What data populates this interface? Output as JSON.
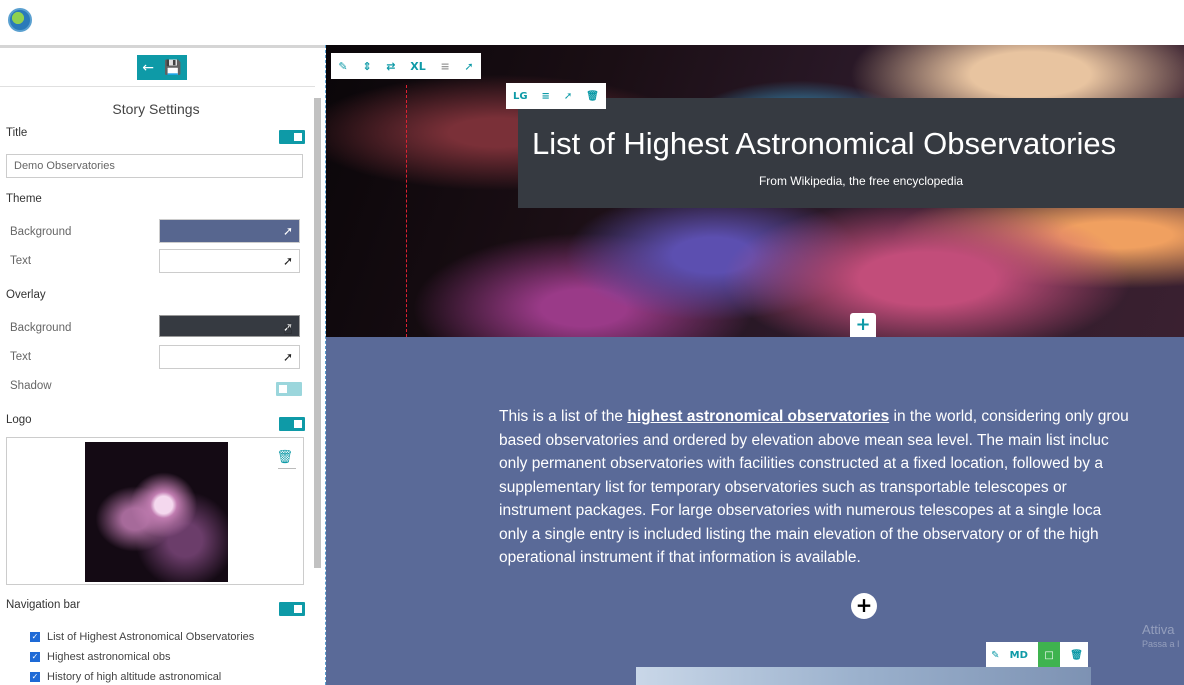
{
  "sidebar": {
    "title": "Story Settings",
    "title_field": {
      "label": "Title",
      "value": "Demo Observatories"
    },
    "theme": {
      "label": "Theme",
      "background": {
        "label": "Background",
        "color": "#57668f"
      },
      "text": {
        "label": "Text",
        "color": "#ffffff"
      }
    },
    "overlay": {
      "label": "Overlay",
      "background": {
        "label": "Background",
        "color": "#363a41"
      },
      "text": {
        "label": "Text",
        "color": "#ffffff"
      },
      "shadow": {
        "label": "Shadow",
        "enabled": false
      }
    },
    "logo": {
      "label": "Logo",
      "enabled": true
    },
    "navigation": {
      "label": "Navigation bar",
      "enabled": true,
      "items": [
        {
          "label": "List of Highest Astronomical Observatories",
          "checked": true
        },
        {
          "label": "Highest astronomical obs",
          "checked": true
        },
        {
          "label": "History of high altitude astronomical",
          "checked": true
        }
      ]
    }
  },
  "hero": {
    "toolbar": [
      "pencil-icon",
      "expand-vertical-icon",
      "fit-icon",
      "XL",
      "align-icon",
      "eyedropper-icon"
    ],
    "title_toolbar": [
      "LG",
      "align-icon",
      "eyedropper-icon",
      "trash-icon"
    ],
    "title": "List of Highest Astronomical Observatories",
    "subtitle": "From Wikipedia, the free encyclopedia"
  },
  "body": {
    "intro_before_link": "This is a list of the ",
    "link": "highest astronomical observatories",
    "line1_rest": " in the world, considering only grou",
    "line2": "based observatories and ordered by elevation above mean sea level. The main list incluc",
    "line3": "only permanent observatories with facilities constructed at a fixed location, followed by a",
    "line4": "supplementary list for temporary observatories such as transportable telescopes or",
    "line5": "instrument packages. For large observatories with numerous telescopes at a single loca",
    "line6": "only a single entry is included listing the main elevation of the observatory or of the high",
    "line7": "operational instrument if that information is available.",
    "image_toolbar_size": "MD"
  },
  "watermark": {
    "line1": "Attiva",
    "line2": "Passa a I"
  },
  "colors": {
    "accent": "#0e9aa7",
    "body_bg": "#5a6a98",
    "overlay": "#363a41"
  }
}
